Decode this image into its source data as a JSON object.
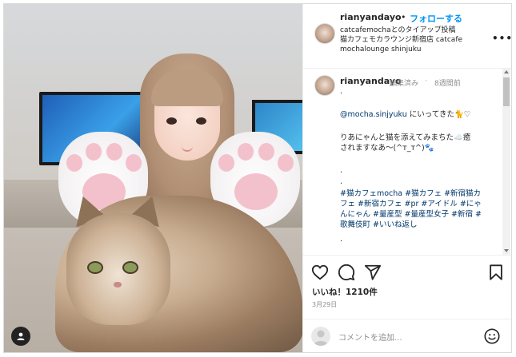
{
  "post": {
    "username": "rianyandayo",
    "follow_label": "フォローする",
    "separator": "•",
    "collab_line": "catcafemochaとのタイアップ投稿",
    "location_line1": "猫カフェモカラウンジ新宿店 catcafe",
    "location_line2": "mochalounge shinjuku",
    "more_icon": "more-icon"
  },
  "caption": {
    "username": "rianyandayo",
    "edited": "編集済み",
    "separator": "·",
    "time": "8週間前",
    "dot1": ".",
    "mention": "@mocha.sinjyuku",
    "mention_rest": " にいってきた🐈♡",
    "line2a": "りあにゃんと猫を添えてみまちた☁️癒",
    "line2b": "されますなあ〜(^т_т^)🐾",
    "dot2": ".",
    "dot3": ".",
    "tags1": "#猫カフェmocha #猫カフェ #新宿猫カ",
    "tags2": "フェ #新宿カフェ #pr #アイドル #にゃ",
    "tags3": "んにゃん #量産型 #量産型女子 #新宿 #",
    "tags4": "歌舞伎町 #いいね返し",
    "dot4": "."
  },
  "actions": {
    "likes": "いいね！1210件",
    "date": "3月29日"
  },
  "comment": {
    "placeholder": "コメントを追加..."
  },
  "colors": {
    "link_blue": "#0095f6",
    "hashtag": "#00376b",
    "text": "#262626",
    "muted": "#8e8e8e"
  }
}
